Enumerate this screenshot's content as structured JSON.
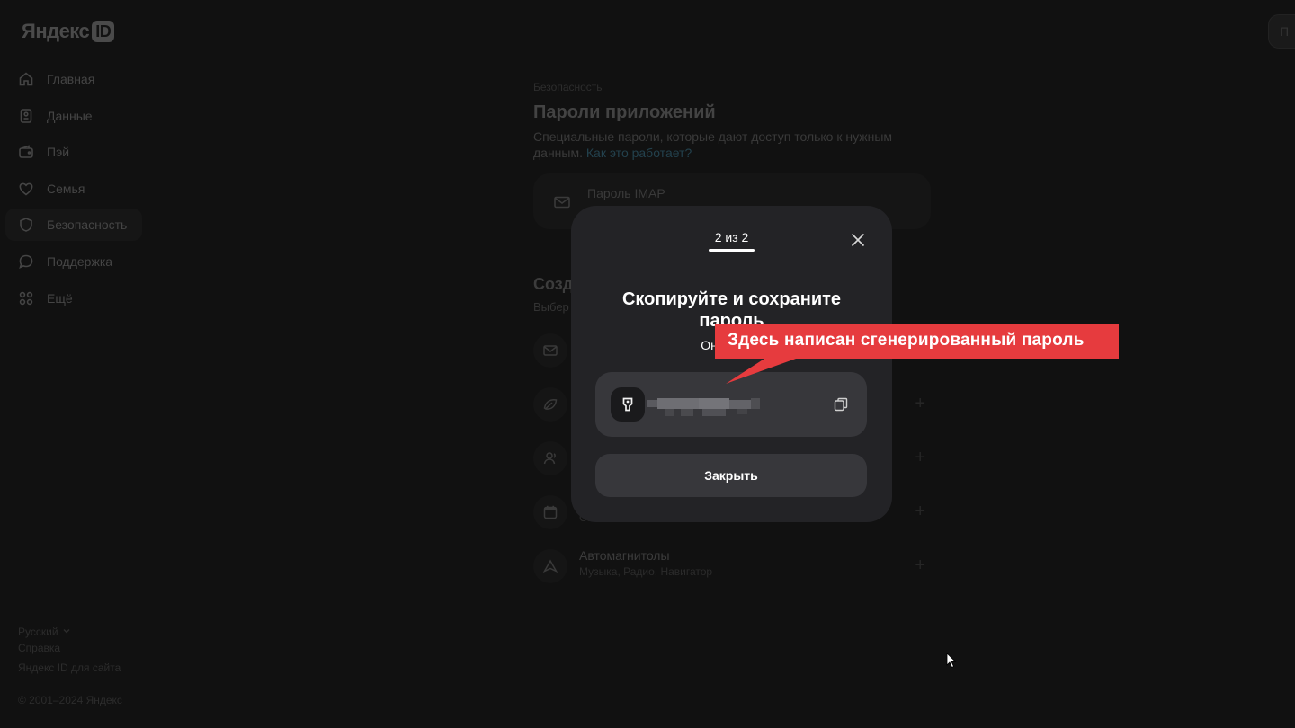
{
  "brand": {
    "logo_text": "Яндекс",
    "logo_badge": "ID"
  },
  "header": {
    "right_button_label": "П"
  },
  "sidebar": {
    "items": [
      {
        "label": "Главная",
        "icon": "home-icon"
      },
      {
        "label": "Данные",
        "icon": "id-card-icon"
      },
      {
        "label": "Пэй",
        "icon": "wallet-icon"
      },
      {
        "label": "Семья",
        "icon": "heart-icon"
      },
      {
        "label": "Безопасность",
        "icon": "shield-icon",
        "active": true
      },
      {
        "label": "Поддержка",
        "icon": "chat-icon"
      },
      {
        "label": "Ещё",
        "icon": "grid-icon"
      }
    ]
  },
  "footer": {
    "language": "Русский",
    "help": "Справка",
    "for_site": "Яндекс ID для сайта",
    "copyright": "© 2001–2024 Яндекс"
  },
  "main": {
    "breadcrumb": "Безопасность",
    "title": "Пароли приложений",
    "description": "Специальные пароли, которые дают доступ только к нужным данным.",
    "description_link": "Как это работает?",
    "existing_password": "Пароль IMAP",
    "create_title": "Созда",
    "create_subtitle": "Выбер",
    "apps": [
      {
        "name": "",
        "sub": "",
        "icon": "mail-icon"
      },
      {
        "name": "",
        "sub": "",
        "icon": "leaf-icon"
      },
      {
        "name": "",
        "sub": "",
        "icon": "contacts-icon"
      },
      {
        "name": "",
        "sub": "Салоно",
        "icon": "calendar-icon"
      },
      {
        "name": "Автомагнитолы",
        "sub": "Музыка, Радио, Навигатор",
        "icon": "navigator-icon"
      }
    ]
  },
  "modal": {
    "step": "2 из 2",
    "title": "Скопируйте и сохраните пароль",
    "note": "Он показы",
    "close_button": "Закрыть",
    "password_masked": true
  },
  "annotation": {
    "text": "Здесь написан сгенерированный пароль",
    "color": "#e63b3e"
  }
}
